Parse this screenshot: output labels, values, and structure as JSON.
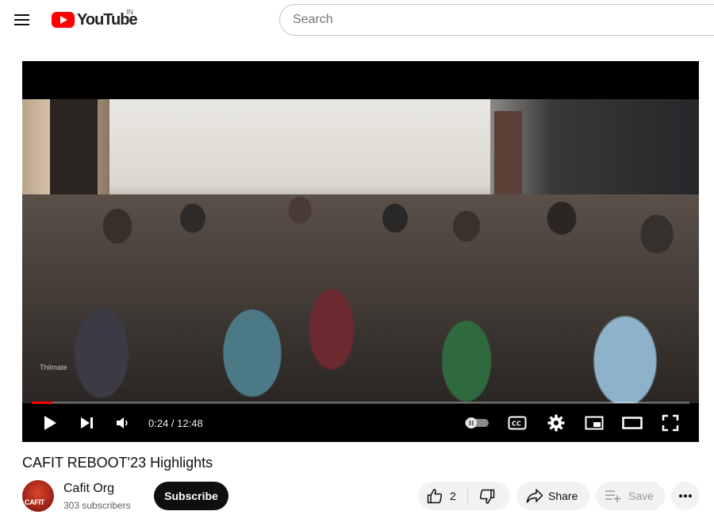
{
  "header": {
    "logo_text": "YouTube",
    "country_code": "IN",
    "search_placeholder": "Search"
  },
  "player": {
    "watermark": "Thilmate",
    "time_display": "0:24 / 12:48",
    "progress_fraction": 0.0313
  },
  "video": {
    "title": "CAFIT REBOOT'23 Highlights"
  },
  "channel": {
    "name": "Cafit Org",
    "subscribers": "303 subscribers",
    "avatar_text": "CAFIT",
    "subscribe_label": "Subscribe"
  },
  "actions": {
    "like_count": "2",
    "share_label": "Share",
    "save_label": "Save"
  },
  "colors": {
    "brand_red": "#ff0000",
    "progress_red": "#ff0000",
    "subscribe_bg": "#0f0f0f"
  }
}
